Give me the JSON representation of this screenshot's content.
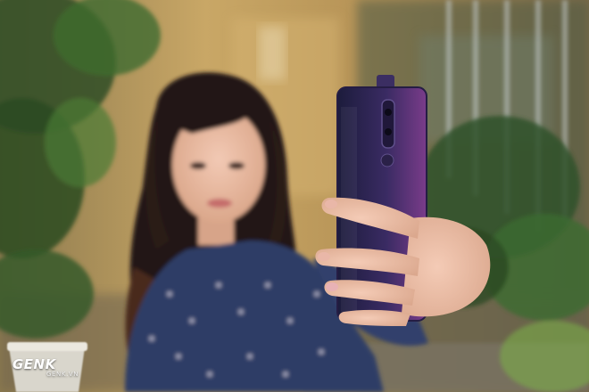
{
  "photo": {
    "subject": "woman-taking-selfie",
    "device": "purple-smartphone-rear-view",
    "colors": {
      "wall": "#c9a766",
      "foliage": "#3f6b2e",
      "phone": "#3a2b63",
      "shirt": "#2f3c66",
      "hair": "#241818"
    }
  },
  "watermark": {
    "brand": "GENK",
    "domain": "GENK.VN"
  }
}
